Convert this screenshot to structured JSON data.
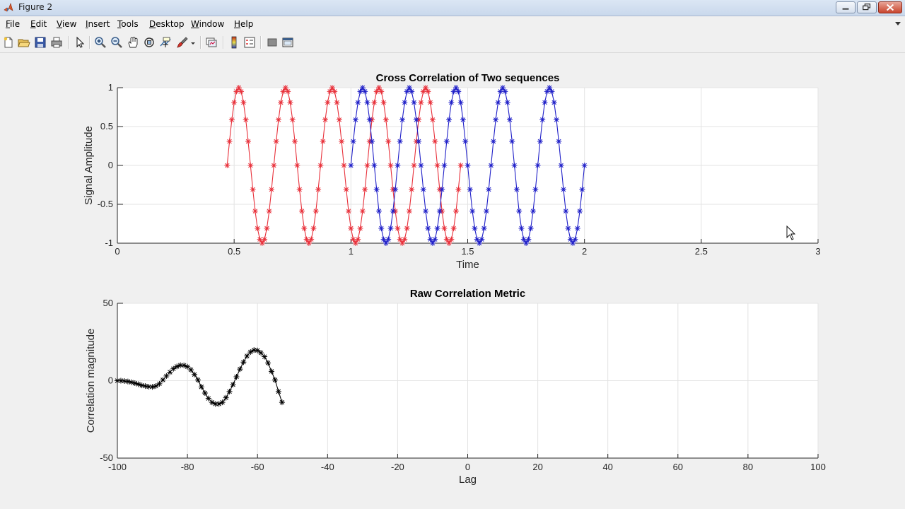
{
  "window": {
    "title": "Figure 2",
    "app_icon": "matlab-icon",
    "controls": [
      "minimize-icon",
      "maximize-icon",
      "close-icon"
    ]
  },
  "menubar": {
    "items": [
      {
        "label": "File",
        "mnemonic": "F"
      },
      {
        "label": "Edit",
        "mnemonic": "E"
      },
      {
        "label": "View",
        "mnemonic": "V"
      },
      {
        "label": "Insert",
        "mnemonic": "I"
      },
      {
        "label": "Tools",
        "mnemonic": "T"
      },
      {
        "label": "Desktop",
        "mnemonic": "D"
      },
      {
        "label": "Window",
        "mnemonic": "W"
      },
      {
        "label": "Help",
        "mnemonic": "H"
      }
    ]
  },
  "toolbar": {
    "buttons": [
      "new-figure-icon",
      "open-file-icon",
      "save-icon",
      "print-icon",
      "edit-plot-arrow-icon",
      "zoom-in-icon",
      "zoom-out-icon",
      "pan-hand-icon",
      "rotate-3d-icon",
      "data-cursor-icon",
      "brush-icon",
      "link-plot-icon",
      "insert-colorbar-icon",
      "insert-legend-icon",
      "hide-plot-tools-icon",
      "show-plot-tools-icon"
    ]
  },
  "chart_data": [
    {
      "type": "line",
      "title": "Cross Correlation of Two sequences",
      "xlabel": "Time",
      "ylabel": "Signal Amplitude",
      "xlim": [
        0,
        3
      ],
      "ylim": [
        -1,
        1
      ],
      "xticks": [
        "0",
        "0.5",
        "1",
        "1.5",
        "2",
        "2.5",
        "3"
      ],
      "yticks": [
        "-1",
        "-0.5",
        "0",
        "0.5",
        "1"
      ],
      "grid": true,
      "marker": "*",
      "series": [
        {
          "color": "#e8303a",
          "frequency_hz": 5,
          "x_start": 0.47,
          "x_end": 1.47,
          "step": 0.01
        },
        {
          "color": "#1f1fc8",
          "frequency_hz": 5,
          "x_start": 1.0,
          "x_end": 2.0,
          "step": 0.01
        }
      ]
    },
    {
      "type": "line",
      "title": "Raw Correlation Metric",
      "xlabel": "Lag",
      "ylabel": "Correlation magnitude",
      "xlim": [
        -100,
        100
      ],
      "ylim": [
        -50,
        50
      ],
      "xticks": [
        "-100",
        "-80",
        "-60",
        "-40",
        "-20",
        "0",
        "20",
        "40",
        "60",
        "80",
        "100"
      ],
      "yticks": [
        "-50",
        "0",
        "50"
      ],
      "grid": true,
      "marker": "*",
      "series": [
        {
          "color": "#000000",
          "x": [
            -100,
            -99,
            -98,
            -97,
            -96,
            -95,
            -94,
            -93,
            -92,
            -91,
            -90,
            -89,
            -88,
            -87,
            -86,
            -85,
            -84,
            -83,
            -82,
            -81,
            -80,
            -79,
            -78,
            -77,
            -76,
            -75,
            -74,
            -73,
            -72,
            -71,
            -70,
            -69,
            -68,
            -67,
            -66,
            -65,
            -64,
            -63,
            -62,
            -61,
            -60,
            -59,
            -58,
            -57,
            -56,
            -55,
            -54,
            -53
          ],
          "y": [
            0,
            0,
            -0.2,
            -0.5,
            -1,
            -1.6,
            -2.3,
            -3,
            -3.5,
            -3.9,
            -4,
            -3.5,
            -2,
            0.5,
            3,
            5.5,
            7.7,
            9.2,
            10,
            9.9,
            9,
            7,
            4,
            0.5,
            -4,
            -8,
            -11.5,
            -14,
            -15,
            -15,
            -14,
            -11,
            -7,
            -2.5,
            2.5,
            7.5,
            12,
            16,
            18.5,
            19.8,
            19.5,
            18,
            15.5,
            11.5,
            6,
            0.5,
            -7,
            -14
          ]
        }
      ]
    }
  ],
  "cursor": "mouse-pointer-icon"
}
